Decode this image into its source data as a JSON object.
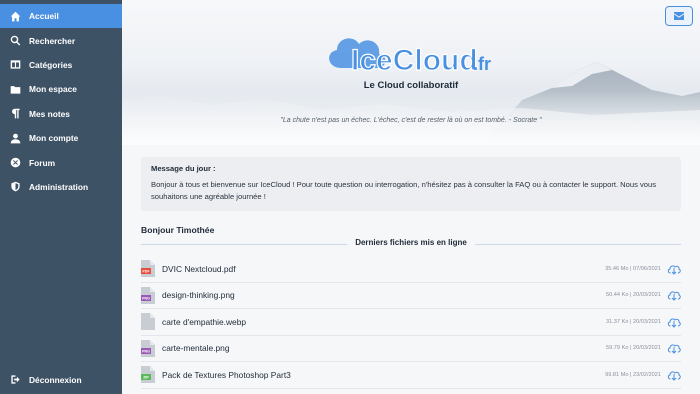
{
  "sidebar": {
    "items": [
      {
        "label": "Accueil",
        "icon": "home-icon",
        "active": true
      },
      {
        "label": "Rechercher",
        "icon": "search-icon"
      },
      {
        "label": "Catégories",
        "icon": "columns-icon"
      },
      {
        "label": "Mon espace",
        "icon": "folder-icon"
      },
      {
        "label": "Mes notes",
        "icon": "paragraph-icon"
      },
      {
        "label": "Mon compte",
        "icon": "user-icon"
      },
      {
        "label": "Forum",
        "icon": "compass-icon"
      },
      {
        "label": "Administration",
        "icon": "shield-icon"
      }
    ],
    "logout": {
      "label": "Déconnexion",
      "icon": "sign-out-icon"
    }
  },
  "hero": {
    "logo_text": "IceCloud",
    "logo_tld": ".fr",
    "tagline": "Le Cloud collaboratif",
    "quote": "\"La chute n'est pas un échec. L'échec, c'est de rester là où on est tombé. - Socrate \""
  },
  "motd": {
    "title": "Message du jour :",
    "text": "Bonjour à tous et bienvenue sur IceCloud ! Pour toute question ou interrogation, n'hésitez pas à consulter la FAQ ou à contacter le support. Nous vous souhaitons une agréable journée !"
  },
  "greeting": "Bonjour Timothée",
  "files_heading": "Derniers fichiers mis en ligne",
  "files": [
    {
      "name": "DVIC Nextcloud.pdf",
      "type": "PDF",
      "size": "35.46 Mo",
      "date": "07/06/2021",
      "color": "#e74c3c"
    },
    {
      "name": "design-thinking.png",
      "type": "PNG",
      "size": "50.44 Ko",
      "date": "20/03/2021",
      "color": "#9b59b6"
    },
    {
      "name": "carte d'empathie.webp",
      "type": "",
      "size": "31.37 Ko",
      "date": "20/03/2021",
      "color": "#c8cdd3"
    },
    {
      "name": "carte-mentale.png",
      "type": "PNG",
      "size": "59.79 Ko",
      "date": "20/03/2021",
      "color": "#9b59b6"
    },
    {
      "name": "Pack de Textures Photoshop Part3",
      "type": "ZIP",
      "size": "99.81 Mo",
      "date": "23/02/2021",
      "color": "#5cb85c"
    }
  ],
  "colors": {
    "sidebar": "#3e5266",
    "accent": "#4a90e2"
  }
}
